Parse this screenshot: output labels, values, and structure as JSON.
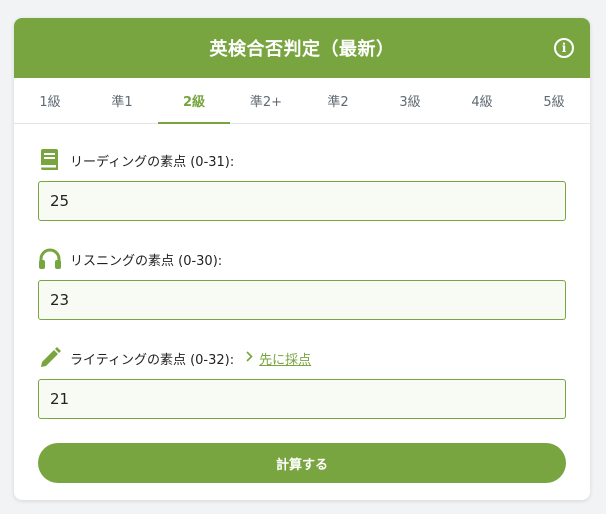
{
  "header": {
    "title": "英検合否判定（最新）",
    "info_icon": "info-icon"
  },
  "tabs": [
    {
      "label": "1級",
      "active": false
    },
    {
      "label": "準1",
      "active": false
    },
    {
      "label": "2級",
      "active": true
    },
    {
      "label": "準2+",
      "active": false
    },
    {
      "label": "準2",
      "active": false
    },
    {
      "label": "3級",
      "active": false
    },
    {
      "label": "4級",
      "active": false
    },
    {
      "label": "5級",
      "active": false
    }
  ],
  "fields": {
    "reading": {
      "icon": "book-icon",
      "label": "リーディングの素点 (0-31):",
      "value": "25"
    },
    "listening": {
      "icon": "headphones-icon",
      "label": "リスニングの素点 (0-30):",
      "value": "23"
    },
    "writing": {
      "icon": "pencil-icon",
      "label": "ライティングの素点 (0-32):",
      "value": "21",
      "link_label": "先に採点",
      "link_icon": "chevron-right-icon"
    }
  },
  "calculate_label": "計算する",
  "colors": {
    "accent": "#78a540",
    "background": "#f2f3f4",
    "input_bg": "#f8fbf4"
  }
}
